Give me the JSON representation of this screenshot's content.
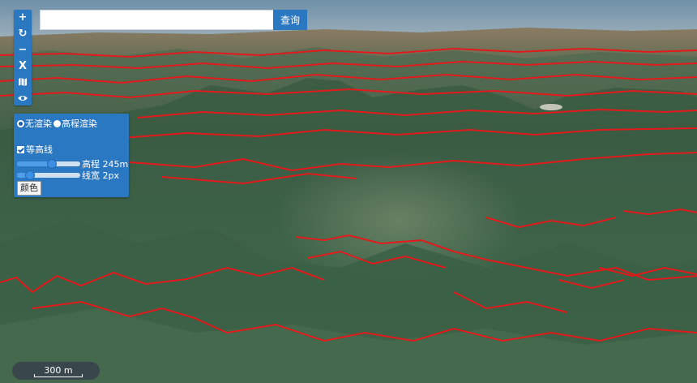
{
  "search": {
    "value": "",
    "placeholder": "",
    "button_label": "查询"
  },
  "toolbar": {
    "zoom_in": "+",
    "reset": "↻",
    "zoom_out": "−",
    "close": "X",
    "map_icon": "map-icon",
    "eye_icon": "eye-icon"
  },
  "panel": {
    "render_options": [
      {
        "label": "无渲染",
        "checked": true
      },
      {
        "label": "高程渲染",
        "checked": false
      }
    ],
    "contour": {
      "label": "等高线",
      "checked": true
    },
    "elevation": {
      "label": "高程 245m",
      "level": 0.55
    },
    "line_width": {
      "label": "线宽 2px",
      "level": 0.2
    },
    "color_button": "颜色"
  },
  "scale_bar": {
    "label": "300 m"
  },
  "colors": {
    "contour_line": "#e31a1c",
    "ui_accent": "#2b78c2",
    "sky": "#7f9db4"
  }
}
